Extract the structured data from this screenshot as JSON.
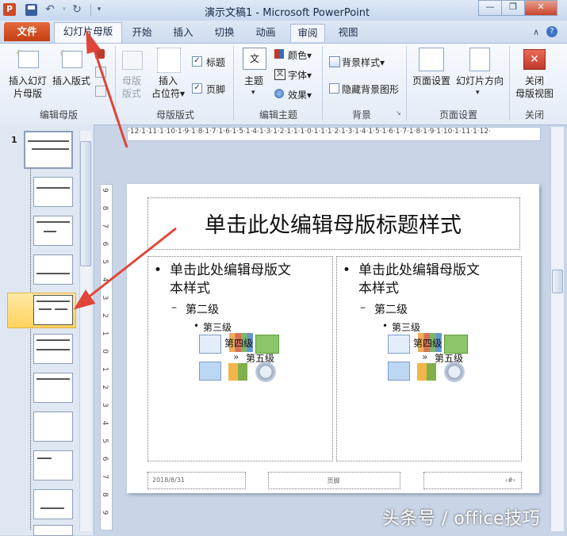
{
  "window": {
    "app_icon": "P",
    "title": "演示文稿1 - Microsoft PowerPoint",
    "undo_icon": "undo-icon",
    "redo_icon": "redo-icon"
  },
  "tabs": {
    "file": "文件",
    "slide_master": "幻灯片母版",
    "home": "开始",
    "insert": "插入",
    "transitions": "切换",
    "animations": "动画",
    "review": "审阅",
    "view": "视图"
  },
  "ribbon": {
    "insert_slide_master": "插入幻灯\n片母版",
    "insert_layout": "插入版式",
    "master_layout": "母版\n版式",
    "insert_placeholder": "插入\n占位符▾",
    "title_check": "标题",
    "footer_check": "页脚",
    "themes": "主题",
    "colors": "颜色▾",
    "fonts": "字体▾",
    "effects": "效果▾",
    "background_styles": "背景样式▾",
    "hide_background": "隐藏背景图形",
    "page_setup": "页面设置",
    "slide_orientation": "幻灯片方向",
    "close_master_view": "关闭\n母版视图",
    "groups": {
      "edit_master": "编辑母版",
      "master_layout": "母版版式",
      "edit_theme": "编辑主题",
      "background": "背景",
      "page_setup": "页面设置",
      "close": "关闭"
    }
  },
  "slide_panel": {
    "first_number": "1"
  },
  "ruler": {
    "h_text": "·12·1·11·1·10·1·9·1·8·1·7·1·6·1·5·1·4·1·3·1·2·1·1·1·0·1·1·1·2·1·3·1·4·1·5·1·6·1·7·1·8·1·9·1·10·1·11·1·12·",
    "v_text": "9 8 7 6 5 4 3 2 1 0 1 2 3 4 5 6 7 8 9"
  },
  "slide": {
    "title": "单击此处编辑母版标题样式",
    "left": {
      "level1_line1": "单击此处编辑母版文",
      "level1_line2": "本样式",
      "level2": "第二级",
      "level3": "第三级",
      "level4": "第四级",
      "level5": "第五级"
    },
    "right": {
      "level1_line1": "单击此处编辑母版文",
      "level1_line2": "本样式",
      "level2": "第二级",
      "level3": "第三级",
      "level4": "第四级",
      "level5": "第五级"
    },
    "footer_date": "2018/8/31",
    "footer_text": "页脚",
    "footer_number": "‹#›"
  },
  "watermark": "头条号 / office技巧",
  "colors": {
    "arrow": "#e0453a",
    "file_tab": "#d24e1d",
    "selection": "#ffd25e"
  }
}
